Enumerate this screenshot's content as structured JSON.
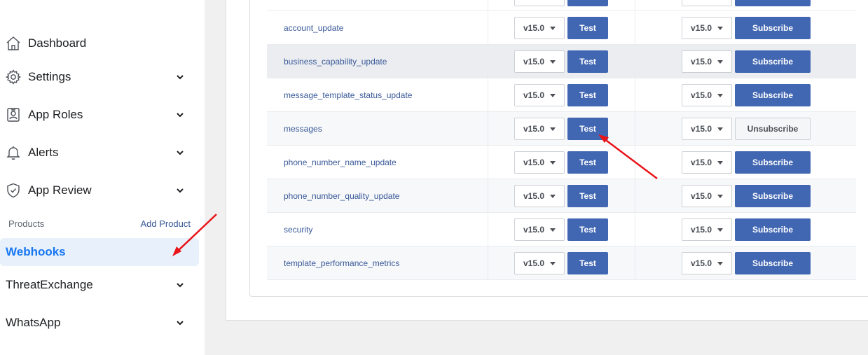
{
  "sidebar": {
    "nav": [
      {
        "label": "Dashboard",
        "icon": "home-icon",
        "has_chevron": false
      },
      {
        "label": "Settings",
        "icon": "gear-icon",
        "has_chevron": true
      },
      {
        "label": "App Roles",
        "icon": "user-badge-icon",
        "has_chevron": true
      },
      {
        "label": "Alerts",
        "icon": "bell-icon",
        "has_chevron": true
      },
      {
        "label": "App Review",
        "icon": "shield-check-icon",
        "has_chevron": true
      }
    ],
    "products_label": "Products",
    "add_product_label": "Add Product",
    "active_item": "Webhooks",
    "products": [
      {
        "label": "ThreatExchange"
      },
      {
        "label": "WhatsApp"
      }
    ]
  },
  "webhooks_table": {
    "rows": [
      {
        "field": "account_update",
        "test_version": "v15.0",
        "test_label": "Test",
        "sub_version": "v15.0",
        "sub_label": "Subscribe",
        "subscribed": false
      },
      {
        "field": "business_capability_update",
        "test_version": "v15.0",
        "test_label": "Test",
        "sub_version": "v15.0",
        "sub_label": "Subscribe",
        "subscribed": false
      },
      {
        "field": "message_template_status_update",
        "test_version": "v15.0",
        "test_label": "Test",
        "sub_version": "v15.0",
        "sub_label": "Subscribe",
        "subscribed": false
      },
      {
        "field": "messages",
        "test_version": "v15.0",
        "test_label": "Test",
        "sub_version": "v15.0",
        "sub_label": "Unsubscribe",
        "subscribed": true
      },
      {
        "field": "phone_number_name_update",
        "test_version": "v15.0",
        "test_label": "Test",
        "sub_version": "v15.0",
        "sub_label": "Subscribe",
        "subscribed": false
      },
      {
        "field": "phone_number_quality_update",
        "test_version": "v15.0",
        "test_label": "Test",
        "sub_version": "v15.0",
        "sub_label": "Subscribe",
        "subscribed": false
      },
      {
        "field": "security",
        "test_version": "v15.0",
        "test_label": "Test",
        "sub_version": "v15.0",
        "sub_label": "Subscribe",
        "subscribed": false
      },
      {
        "field": "template_performance_metrics",
        "test_version": "v15.0",
        "test_label": "Test",
        "sub_version": "v15.0",
        "sub_label": "Subscribe",
        "subscribed": false
      }
    ]
  },
  "colors": {
    "primary_button": "#4267b2",
    "active_nav_bg": "#e7f0fb",
    "active_nav_text": "#1877f2",
    "annotation_arrow": "#e8141a"
  }
}
